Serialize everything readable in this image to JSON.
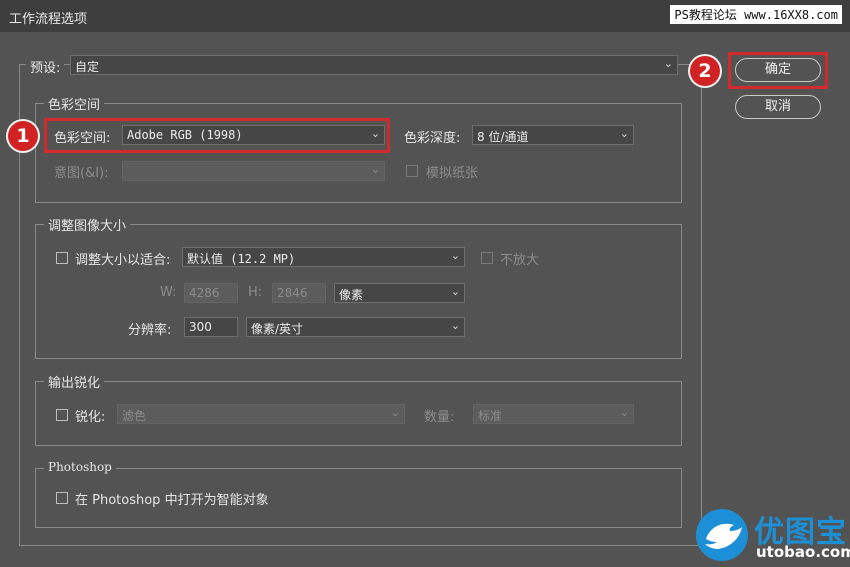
{
  "window": {
    "title": "工作流程选项"
  },
  "watermark": {
    "text": "PS教程论坛 www.16XX8.com"
  },
  "preset": {
    "label": "预设:",
    "value": "自定"
  },
  "buttons": {
    "ok": "确定",
    "cancel": "取消"
  },
  "badges": {
    "one": "1",
    "two": "2"
  },
  "color_space_group": {
    "legend": "色彩空间",
    "space_label": "色彩空间:",
    "space_value": "Adobe RGB (1998)",
    "depth_label": "色彩深度:",
    "depth_value": "8 位/通道",
    "intent_label": "意图(&I):",
    "intent_value": "",
    "simulate_paper_label": "模拟纸张"
  },
  "resize_group": {
    "legend": "调整图像大小",
    "fit_label": "调整大小以适合:",
    "fit_value": "默认值 (12.2 MP)",
    "no_enlarge_label": "不放大",
    "w_label": "W:",
    "w_value": "4286",
    "h_label": "H:",
    "h_value": "2846",
    "unit_value": "像素",
    "resolution_label": "分辨率:",
    "resolution_value": "300",
    "resolution_unit": "像素/英寸"
  },
  "sharpen_group": {
    "legend": "输出锐化",
    "sharpen_label": "锐化:",
    "sharpen_value": "滤色",
    "amount_label": "数量:",
    "amount_value": "标准"
  },
  "photoshop_group": {
    "legend": "Photoshop",
    "smart_object_label": "在 Photoshop 中打开为智能对象"
  },
  "logo": {
    "text": "优图宝",
    "sub": "utobao.com"
  },
  "colors": {
    "highlight": "#d22a2a",
    "dialog_bg": "#535353",
    "brand_blue": "#1d8fd6"
  }
}
